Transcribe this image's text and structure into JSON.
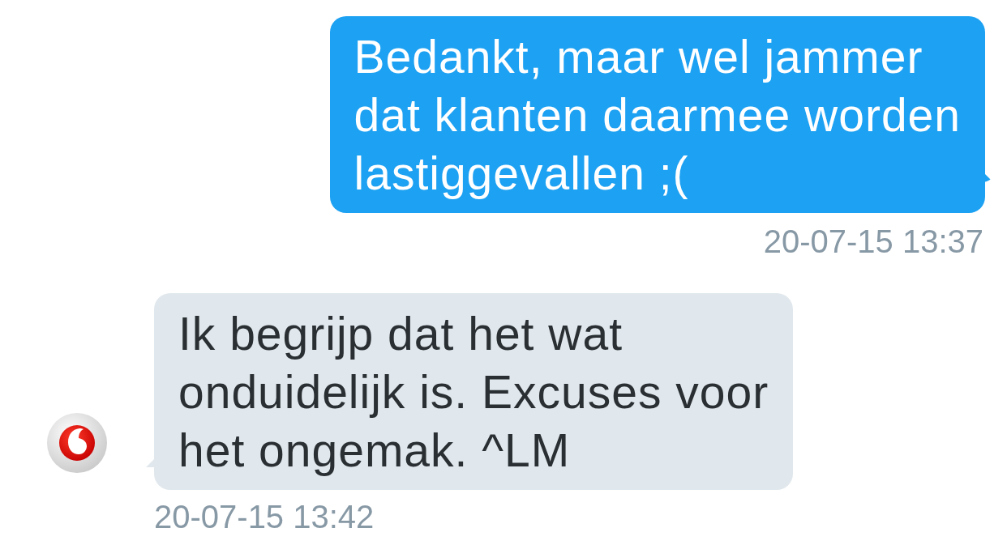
{
  "messages": [
    {
      "kind": "outgoing",
      "text": "Bedankt, maar wel jammer\ndat klanten daarmee worden\nlastiggevallen ;(",
      "timestamp": "20-07-15 13:37"
    },
    {
      "kind": "incoming",
      "text": "Ik begrijp dat het wat\nonduidelijk is. Excuses voor\nhet ongemak. ^LM",
      "timestamp": "20-07-15 13:42"
    }
  ]
}
